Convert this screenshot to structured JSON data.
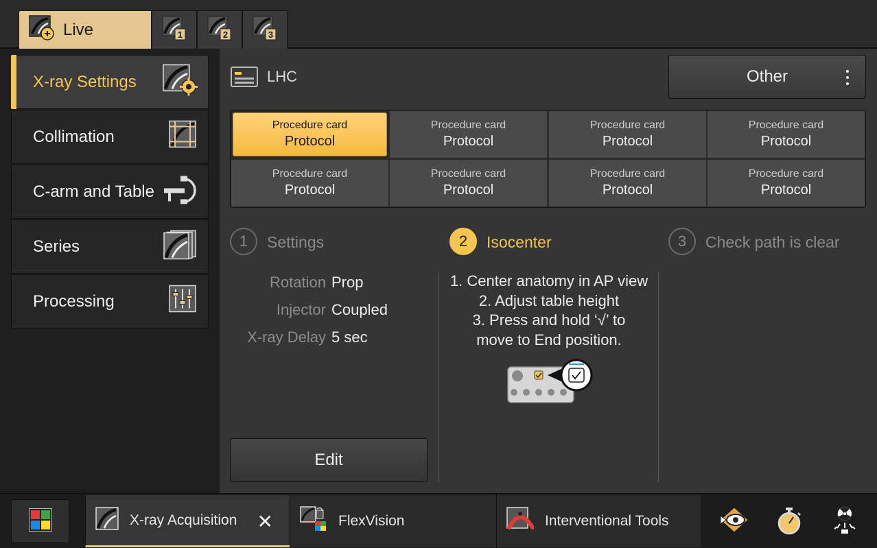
{
  "top_tabs": [
    {
      "label": "Live",
      "icon": "live-xray-icon"
    },
    {
      "label": "",
      "icon": "review-1-icon"
    },
    {
      "label": "",
      "icon": "review-2-icon"
    },
    {
      "label": "",
      "icon": "review-3-icon"
    }
  ],
  "sidebar": {
    "items": [
      {
        "label": "X-ray Settings",
        "icon": "xray-settings-icon",
        "active": true
      },
      {
        "label": "Collimation",
        "icon": "collimation-icon"
      },
      {
        "label": "C-arm and Table",
        "icon": "carm-table-icon"
      },
      {
        "label": "Series",
        "icon": "series-icon"
      },
      {
        "label": "Processing",
        "icon": "processing-icon"
      }
    ]
  },
  "header": {
    "procedure_label": "LHC",
    "other_button": "Other"
  },
  "procedure_cards": [
    {
      "title": "Procedure card",
      "subtitle": "Protocol",
      "selected": true
    },
    {
      "title": "Procedure card",
      "subtitle": "Protocol"
    },
    {
      "title": "Procedure card",
      "subtitle": "Protocol"
    },
    {
      "title": "Procedure card",
      "subtitle": "Protocol"
    },
    {
      "title": "Procedure card",
      "subtitle": "Protocol"
    },
    {
      "title": "Procedure card",
      "subtitle": "Protocol"
    },
    {
      "title": "Procedure card",
      "subtitle": "Protocol"
    },
    {
      "title": "Procedure card",
      "subtitle": "Protocol"
    }
  ],
  "steps": [
    {
      "number": "1",
      "label": "Settings"
    },
    {
      "number": "2",
      "label": "Isocenter",
      "active": true
    },
    {
      "number": "3",
      "label": "Check path is clear"
    }
  ],
  "settings": [
    {
      "key": "Rotation",
      "value": "Prop"
    },
    {
      "key": "Injector",
      "value": "Coupled"
    },
    {
      "key": "X-ray Delay",
      "value": "5 sec"
    }
  ],
  "instructions": [
    "1. Center anatomy in AP view",
    "2. Adjust table height",
    "3. Press and hold ‘√’ to",
    "move to End position."
  ],
  "edit_button": "Edit",
  "bottom_tabs": [
    {
      "label": "X-ray Acquisition",
      "icon": "xray-acquisition-icon",
      "active": true
    },
    {
      "label": "FlexVision",
      "icon": "flexvision-icon"
    },
    {
      "label": "Interventional Tools",
      "icon": "interventional-tools-icon"
    }
  ],
  "colors": {
    "accent": "#f5c451",
    "live_tab": "#e3c78e",
    "panel": "#353535",
    "background": "#1e1e1e"
  }
}
